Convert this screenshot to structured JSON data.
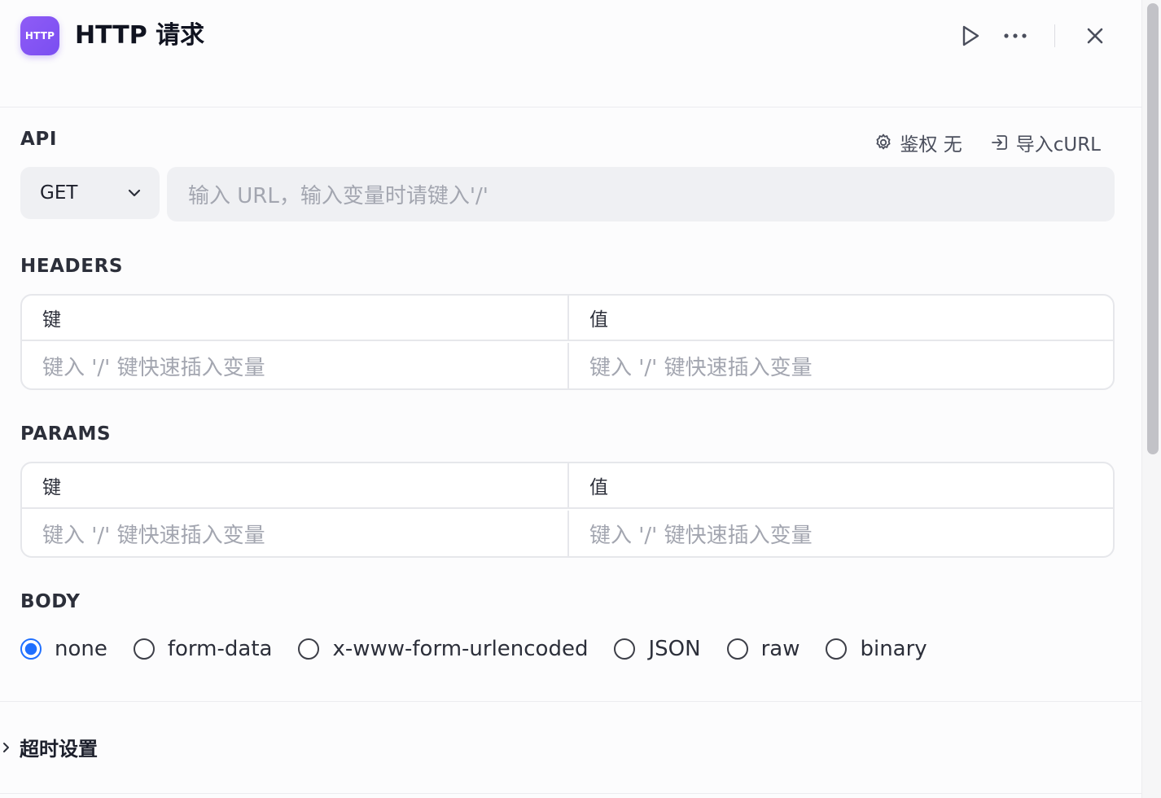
{
  "header": {
    "icon_text": "HTTP",
    "title": "HTTP 请求",
    "run_icon": "play-icon",
    "more_icon": "more-horizontal-icon",
    "close_icon": "close-icon"
  },
  "api": {
    "label": "API",
    "auth_label": "鉴权 无",
    "auth_icon": "gear-icon",
    "import_label": "导入cURL",
    "import_icon": "import-icon",
    "method": "GET",
    "method_icon": "chevron-down-icon",
    "url_placeholder": "输入 URL，输入变量时请键入'/'"
  },
  "headers": {
    "label": "HEADERS",
    "col_key": "键",
    "col_value": "值",
    "key_placeholder": "键入 '/' 键快速插入变量",
    "value_placeholder": "键入 '/' 键快速插入变量"
  },
  "params": {
    "label": "PARAMS",
    "col_key": "键",
    "col_value": "值",
    "key_placeholder": "键入 '/' 键快速插入变量",
    "value_placeholder": "键入 '/' 键快速插入变量"
  },
  "body": {
    "label": "BODY",
    "selected": "none",
    "options": [
      "none",
      "form-data",
      "x-www-form-urlencoded",
      "JSON",
      "raw",
      "binary"
    ]
  },
  "timeout": {
    "label": "超时设置",
    "icon": "chevron-right-icon"
  },
  "colors": {
    "accent": "#1f6fff",
    "brand_purple": "#7a4ef1"
  }
}
